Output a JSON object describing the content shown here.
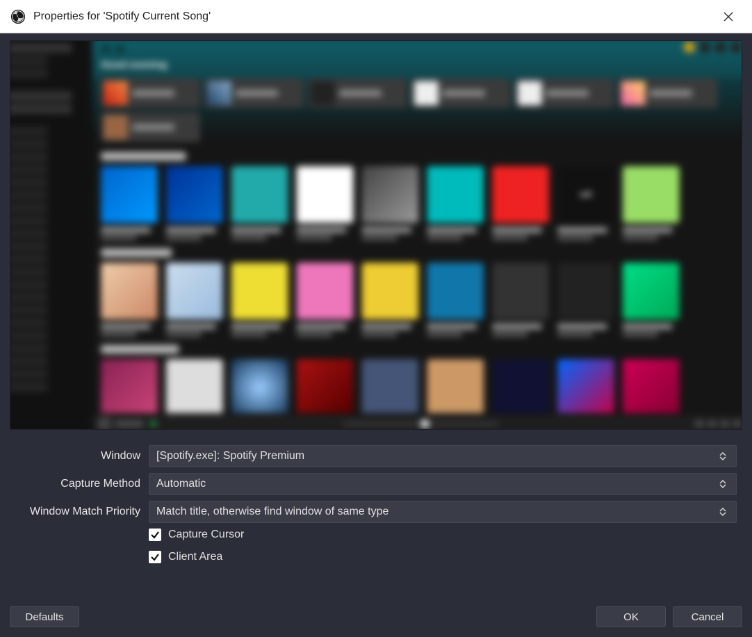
{
  "title": "Properties for 'Spotify Current Song'",
  "form": {
    "window_label": "Window",
    "window_value": "[Spotify.exe]: Spotify Premium",
    "capture_method_label": "Capture Method",
    "capture_method_value": "Automatic",
    "match_priority_label": "Window Match Priority",
    "match_priority_value": "Match title, otherwise find window of same type",
    "capture_cursor_label": "Capture Cursor",
    "capture_cursor_checked": true,
    "client_area_label": "Client Area",
    "client_area_checked": true
  },
  "buttons": {
    "defaults": "Defaults",
    "ok": "OK",
    "cancel": "Cancel"
  },
  "preview": {
    "greeting": "Good evening"
  }
}
